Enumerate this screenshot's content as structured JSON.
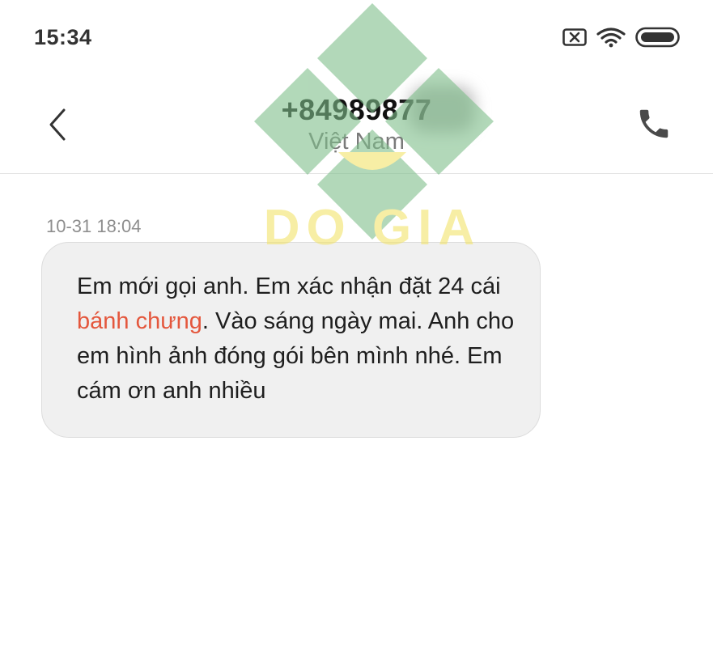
{
  "status_bar": {
    "time": "15:34",
    "icons": [
      "no-sim-icon",
      "wifi-icon",
      "battery-icon"
    ]
  },
  "header": {
    "title": "+84989877",
    "subtitle": "Việt Nam",
    "back_icon": "chevron-left-icon",
    "call_icon": "phone-icon"
  },
  "conversation": {
    "messages": [
      {
        "timestamp": "10-31 18:04",
        "text_before": "Em mới gọi anh. Em xác nhận đặt 24 cái ",
        "link_text": "bánh chưng",
        "text_after": ". Vào sáng ngày mai. Anh cho em hình ảnh đóng gói bên mình nhé. Em cám ơn anh nhiều"
      }
    ]
  },
  "watermark": {
    "text": "DO GIA",
    "colors": {
      "diamond": "#7fbf8b",
      "text": "#f3e36a"
    }
  },
  "colors": {
    "link": "#e4573d",
    "bubble": "#f0f0f0"
  }
}
